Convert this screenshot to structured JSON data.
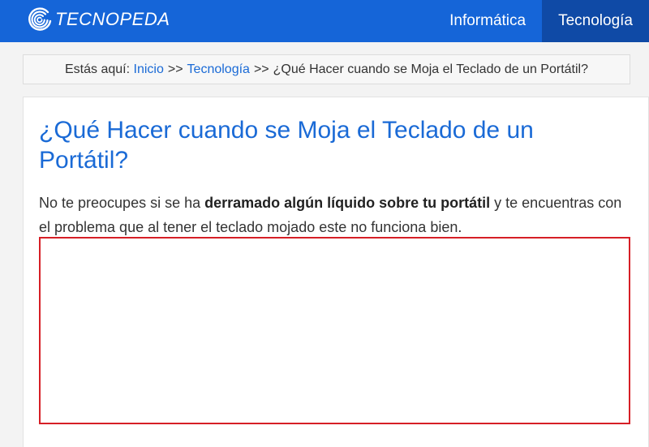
{
  "brand": {
    "name": "TECNOPEDA",
    "logo_icon": "swirl-logo-icon",
    "color": "#1565d8"
  },
  "nav": {
    "items": [
      {
        "label": "Informática",
        "active": false
      },
      {
        "label": "Tecnología",
        "active": true
      }
    ]
  },
  "breadcrumb": {
    "prefix": "Estás aquí:",
    "separator": ">>",
    "links": [
      "Inicio",
      "Tecnología"
    ],
    "current": "¿Qué Hacer cuando se Moja el Teclado de un Portátil?"
  },
  "article": {
    "title": "¿Qué Hacer cuando se Moja el Teclado de un Portátil?",
    "lead_before": "No te preocupes si se ha ",
    "lead_bold": "derramado algún líquido sobre tu portátil",
    "lead_after": " y te encuentras con el problema que al tener el teclado mojado este no funciona bien."
  },
  "colors": {
    "accent": "#1a6ad6",
    "nav_active": "#0f4aa6",
    "ad_border": "#d61f26"
  }
}
